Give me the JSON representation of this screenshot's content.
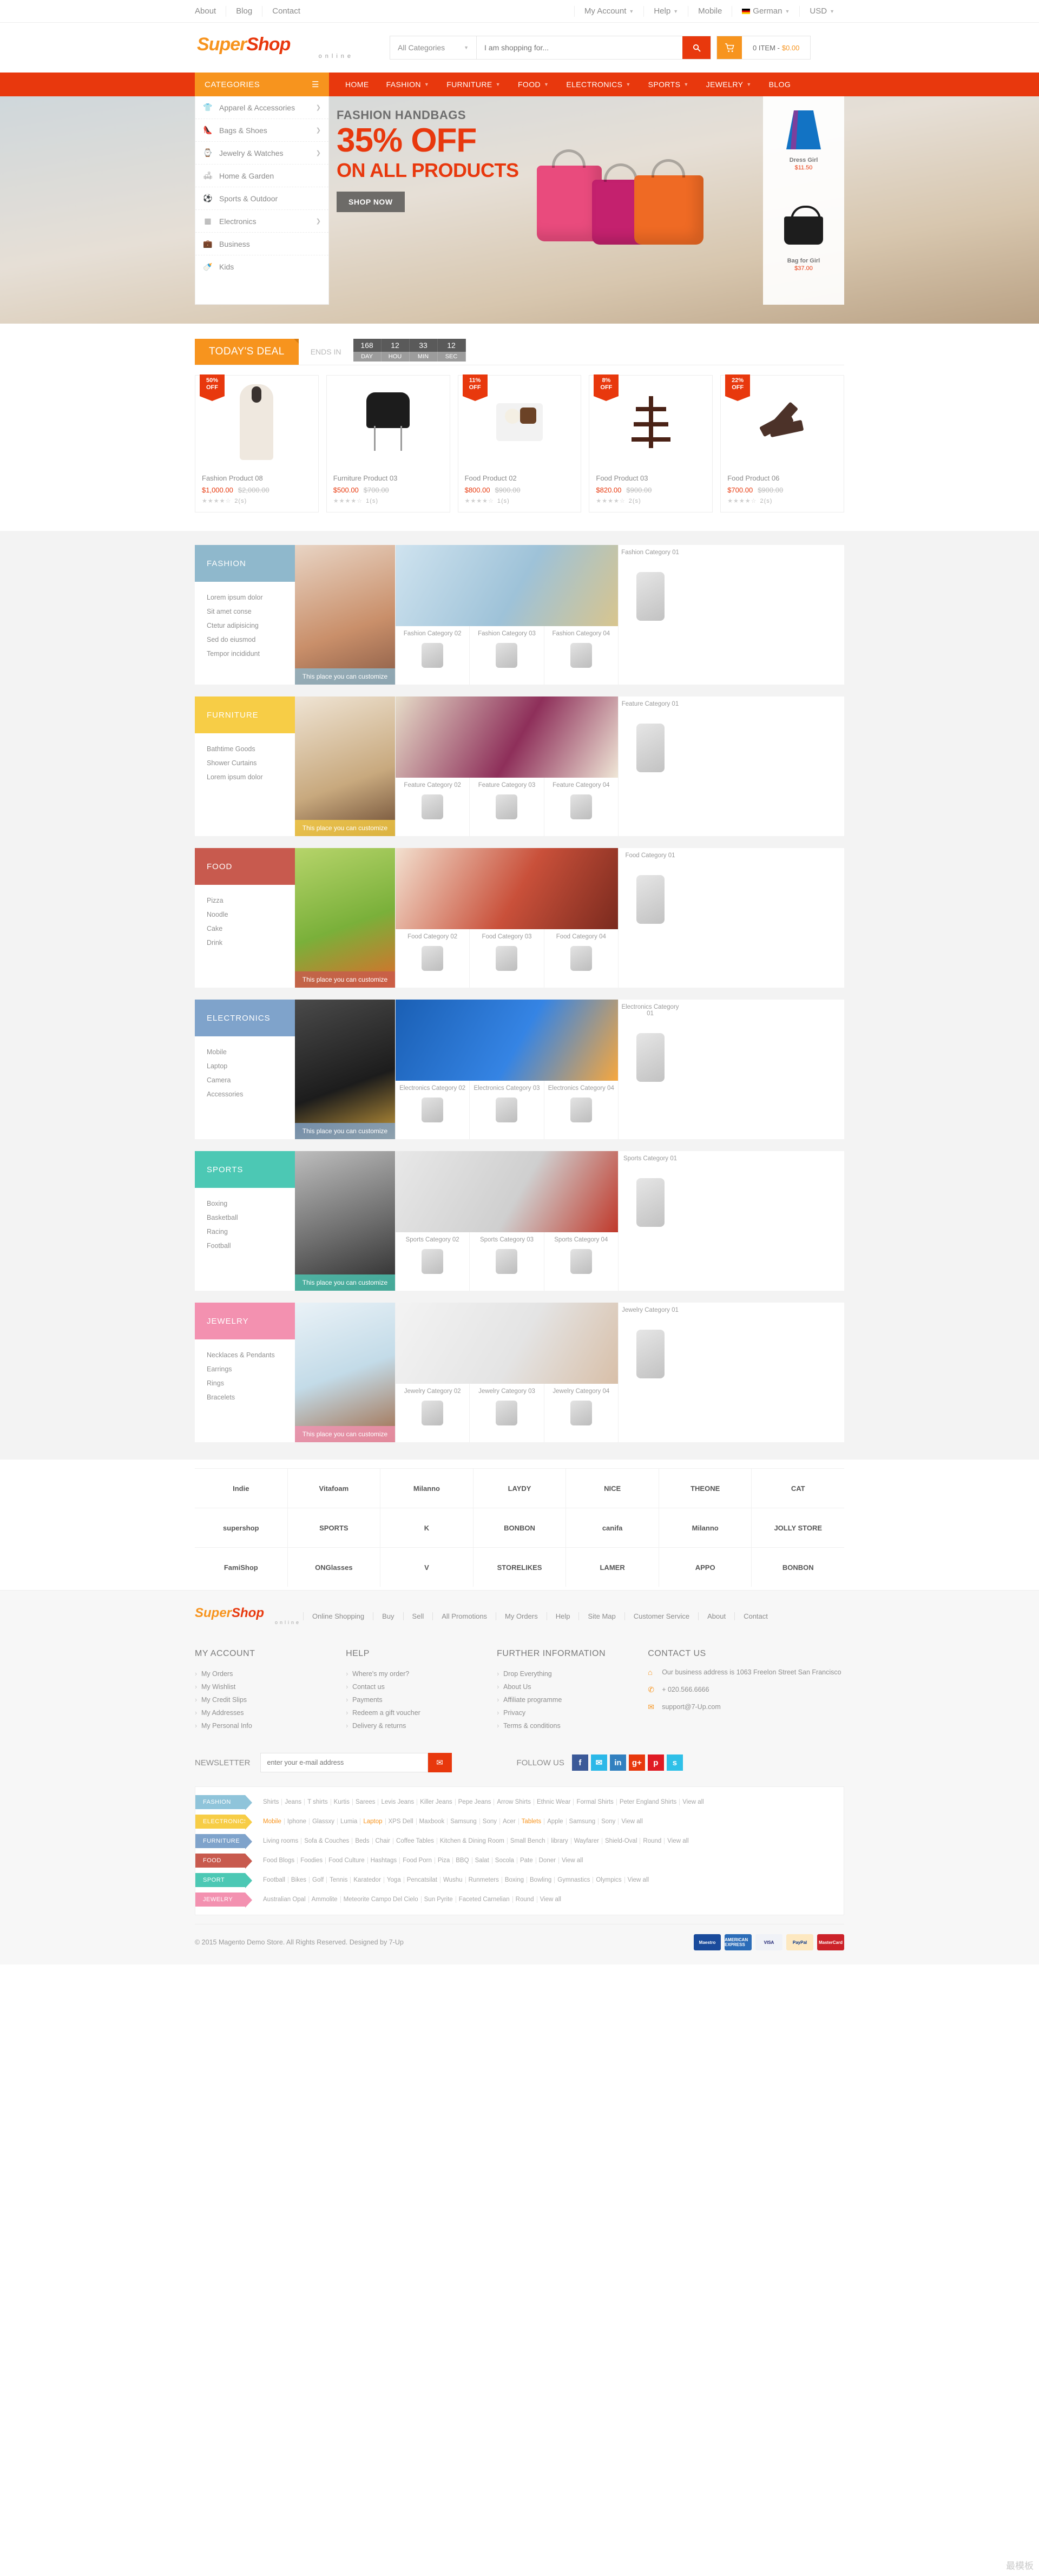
{
  "topbar": {
    "left": [
      "About",
      "Blog",
      "Contact"
    ],
    "right": [
      {
        "label": "My Account",
        "caret": true,
        "icon": null
      },
      {
        "label": "Help",
        "caret": true,
        "icon": null
      },
      {
        "label": "Mobile",
        "caret": false,
        "icon": null
      },
      {
        "label": "German",
        "caret": true,
        "icon": "flag-de-icon"
      },
      {
        "label": "USD",
        "caret": true,
        "icon": null
      }
    ]
  },
  "header": {
    "logo": {
      "part1": "Super",
      "part2": "Shop",
      "tagline": "online"
    },
    "search": {
      "category": "All Categories",
      "placeholder": "I am shopping for...",
      "button_icon": "search-icon"
    },
    "cart": {
      "icon": "cart-icon",
      "count_label": "0 ITEM -",
      "amount": "$0.00"
    }
  },
  "nav": {
    "categories_label": "CATEGORIES",
    "menu_icon": "hamburger-icon",
    "links": [
      {
        "label": "HOME",
        "caret": false
      },
      {
        "label": "FASHION",
        "caret": true
      },
      {
        "label": "FURNITURE",
        "caret": true
      },
      {
        "label": "FOOD",
        "caret": true
      },
      {
        "label": "ELECTRONICS",
        "caret": true
      },
      {
        "label": "SPORTS",
        "caret": true
      },
      {
        "label": "JEWELRY",
        "caret": true
      },
      {
        "label": "BLOG",
        "caret": false
      }
    ]
  },
  "category_panel": [
    {
      "label": "Apparel & Accessories",
      "icon": "tshirt-icon",
      "arrow": true
    },
    {
      "label": "Bags & Shoes",
      "icon": "shoe-icon",
      "arrow": true
    },
    {
      "label": "Jewelry & Watches",
      "icon": "watch-icon",
      "arrow": true
    },
    {
      "label": "Home & Garden",
      "icon": "sofa-icon",
      "arrow": false
    },
    {
      "label": "Sports & Outdoor",
      "icon": "ball-icon",
      "arrow": false
    },
    {
      "label": "Electronics",
      "icon": "chip-icon",
      "arrow": true
    },
    {
      "label": "Business",
      "icon": "briefcase-icon",
      "arrow": false
    },
    {
      "label": "Kids",
      "icon": "bottle-icon",
      "arrow": false
    }
  ],
  "hero": {
    "eyebrow": "FASHION HANDBAGS",
    "headline": "35% OFF",
    "subhead": "ON ALL PRODUCTS",
    "cta": "SHOP NOW",
    "side_products": [
      {
        "name": "Dress Girl",
        "price": "$11.50",
        "art": "skirt"
      },
      {
        "name": "Bag for Girl",
        "price": "$37.00",
        "art": "handbag"
      }
    ]
  },
  "deals": {
    "title": "TODAY'S DEAL",
    "ends_in": "ENDS IN",
    "counter": [
      {
        "value": "168",
        "label": "DAY"
      },
      {
        "value": "12",
        "label": "HOU"
      },
      {
        "value": "33",
        "label": "MIN"
      },
      {
        "value": "12",
        "label": "SEC"
      }
    ],
    "products": [
      {
        "badge": "50%",
        "badge_sub": "OFF",
        "name": "Fashion Product 08",
        "price": "$1,000.00",
        "old": "$2,000.00",
        "stars": 4,
        "reviews": "2(s)",
        "art": "coat"
      },
      {
        "badge": null,
        "badge_sub": null,
        "name": "Furniture Product 03",
        "price": "$500.00",
        "old": "$700.00",
        "stars": 4,
        "reviews": "1(s)",
        "art": "chair"
      },
      {
        "badge": "11%",
        "badge_sub": "OFF",
        "name": "Food Product 02",
        "price": "$800.00",
        "old": "$900.00",
        "stars": 4,
        "reviews": "1(s)",
        "art": "truffle"
      },
      {
        "badge": "8%",
        "badge_sub": "OFF",
        "name": "Food Product 03",
        "price": "$820.00",
        "old": "$900.00",
        "stars": 4,
        "reviews": "2(s)",
        "art": "drizzle"
      },
      {
        "badge": "22%",
        "badge_sub": "OFF",
        "name": "Food Product 06",
        "price": "$700.00",
        "old": "$900.00",
        "stars": 4,
        "reviews": "2(s)",
        "art": "bars"
      }
    ]
  },
  "sections": [
    {
      "title": "FASHION",
      "color": "#8fb8cc",
      "caption": "This place you can customize",
      "links": [
        "Lorem ipsum dolor",
        "Sit amet conse",
        "Ctetur adipisicing",
        "Sed do eiusmod",
        "Tempor incididunt"
      ],
      "cells": [
        {
          "label": "Fashion Category 02",
          "art": "jeans"
        },
        {
          "label": "Fashion Category 03",
          "art": "sunglasses"
        },
        {
          "label": "Fashion Category 04",
          "art": "dress"
        }
      ],
      "right": {
        "label": "Fashion Category 01",
        "art": "blouse"
      },
      "feature_art": "woman-curly",
      "banner_art": "couple-selfie"
    },
    {
      "title": "FURNITURE",
      "color": "#f7cd46",
      "caption": "This place you can customize",
      "links": [
        "Bathtime Goods",
        "Shower Curtains",
        "Lorem ipsum dolor"
      ],
      "cells": [
        {
          "label": "Feature Category 02",
          "art": "dresser"
        },
        {
          "label": "Feature Category 03",
          "art": "stool"
        },
        {
          "label": "Feature Category 04",
          "art": "lamp"
        }
      ],
      "right": {
        "label": "Feature Category 01",
        "art": "lampshade"
      },
      "feature_art": "living-room",
      "banner_art": "purple-sofa"
    },
    {
      "title": "FOOD",
      "color": "#c85a4e",
      "caption": "This place you can customize",
      "links": [
        "Pizza",
        "Noodle",
        "Cake",
        "Drink"
      ],
      "cells": [
        {
          "label": "Food Category 02",
          "art": "coffee-cup"
        },
        {
          "label": "Food Category 03",
          "art": "lime"
        },
        {
          "label": "Food Category 04",
          "art": "glass"
        }
      ],
      "right": {
        "label": "Food Category 01",
        "art": "latte"
      },
      "feature_art": "veggies",
      "banner_art": "meat-dish"
    },
    {
      "title": "ELECTRONICS",
      "color": "#7fa3cb",
      "caption": "This place you can customize",
      "links": [
        "Mobile",
        "Laptop",
        "Camera",
        "Accessories"
      ],
      "cells": [
        {
          "label": "Electronics Category 02",
          "art": "green-phone"
        },
        {
          "label": "Electronics Category 03",
          "art": "white-phone"
        },
        {
          "label": "Electronics Category 04",
          "art": "galaxy-phone"
        }
      ],
      "right": {
        "label": "Electronics Category 01",
        "art": "yellow-camera"
      },
      "feature_art": "dslr-lens",
      "banner_art": "personalize-phone"
    },
    {
      "title": "SPORTS",
      "color": "#4cc8b4",
      "caption": "This place you can customize",
      "links": [
        "Boxing",
        "Basketball",
        "Racing",
        "Football"
      ],
      "cells": [
        {
          "label": "Sports Category 02",
          "art": "blue-helmet"
        },
        {
          "label": "Sports Category 03",
          "art": "red-helmet"
        },
        {
          "label": "Sports Category 04",
          "art": "blue-skirt"
        }
      ],
      "right": {
        "label": "Sports Category 01",
        "art": "racket"
      },
      "feature_art": "man-jacket",
      "banner_art": "red-cleat"
    },
    {
      "title": "JEWELRY",
      "color": "#f391b0",
      "caption": "This place you can customize",
      "links": [
        "Necklaces & Pendants",
        "Earrings",
        "Rings",
        "Bracelets"
      ],
      "cells": [
        {
          "label": "Jewelry Category 02",
          "art": "earrings"
        },
        {
          "label": "Jewelry Category 03",
          "art": "pendant"
        },
        {
          "label": "Jewelry Category 04",
          "art": "gem-ring"
        }
      ],
      "right": {
        "label": "Jewelry Category 01",
        "art": "gold-ring"
      },
      "feature_art": "big-gem",
      "banner_art": "hands-ring"
    }
  ],
  "brands": {
    "row1": [
      "Indie",
      "Vitafoam",
      "Milanno",
      "LAYDY",
      "NICE",
      "THEONE",
      "CAT"
    ],
    "row2": [
      "supershop",
      "SPORTS",
      "K",
      "BONBON",
      "canifa",
      "Milanno",
      "JOLLY STORE"
    ],
    "row3": [
      "FamiShop",
      "ONGlasses",
      "V",
      "STORELIKES",
      "LAMER",
      "APPO",
      "BONBON"
    ]
  },
  "footer": {
    "logo": {
      "part1": "Super",
      "part2": "Shop",
      "tagline": "online"
    },
    "toplinks": [
      "Online Shopping",
      "Buy",
      "Sell",
      "All Promotions",
      "My Orders",
      "Help",
      "Site Map",
      "Customer Service",
      "About",
      "Contact"
    ],
    "columns": [
      {
        "heading": "MY ACCOUNT",
        "items": [
          "My Orders",
          "My Wishlist",
          "My Credit Slips",
          "My Addresses",
          "My Personal Info"
        ]
      },
      {
        "heading": "HELP",
        "items": [
          "Where's my order?",
          "Contact us",
          "Payments",
          "Redeem a gift voucher",
          "Delivery & returns"
        ]
      },
      {
        "heading": "FURTHER INFORMATION",
        "items": [
          "Drop Everything",
          "About Us",
          "Affiliate programme",
          "Privacy",
          "Terms & conditions"
        ]
      }
    ],
    "contact": {
      "heading": "CONTACT US",
      "rows": [
        {
          "icon": "home-icon",
          "text": "Our business address is 1063 Freelon Street San Francisco"
        },
        {
          "icon": "phone-icon",
          "text": "+ 020.566.6666"
        },
        {
          "icon": "mail-icon",
          "text": "support@7-Up.com"
        }
      ]
    },
    "newsletter": {
      "label": "NEWSLETTER",
      "placeholder": "enter your e-mail address",
      "button_icon": "envelope-icon"
    },
    "follow": {
      "label": "FOLLOW US",
      "socials": [
        {
          "name": "facebook-icon",
          "glyph": "f",
          "color": "#3b5998"
        },
        {
          "name": "twitter-icon",
          "glyph": "✉",
          "color": "#2bb8e8"
        },
        {
          "name": "linkedin-icon",
          "glyph": "in",
          "color": "#3280bf"
        },
        {
          "name": "googleplus-icon",
          "glyph": "g+",
          "color": "#e8380d"
        },
        {
          "name": "pinterest-icon",
          "glyph": "p",
          "color": "#e01b24"
        },
        {
          "name": "skype-icon",
          "glyph": "s",
          "color": "#2fc0e8"
        }
      ]
    },
    "tags": [
      {
        "label": "FASHION",
        "color": "#8fc4da",
        "items": [
          {
            "t": "Shirts"
          },
          {
            "t": "Jeans"
          },
          {
            "t": "T shirts"
          },
          {
            "t": "Kurtis"
          },
          {
            "t": "Sarees"
          },
          {
            "t": "Levis Jeans"
          },
          {
            "t": "Killer Jeans"
          },
          {
            "t": "Pepe Jeans"
          },
          {
            "t": "Arrow Shirts"
          },
          {
            "t": "Ethnic Wear"
          },
          {
            "t": "Formal Shirts"
          },
          {
            "t": "Peter England Shirts"
          },
          {
            "t": "View all"
          }
        ]
      },
      {
        "label": "ELECTRONICS",
        "color": "#f7cd46",
        "items": [
          {
            "t": "Mobile",
            "hl": true
          },
          {
            "t": "Iphone"
          },
          {
            "t": "Glassxy"
          },
          {
            "t": "Lumia"
          },
          {
            "t": "Laptop",
            "hl": true
          },
          {
            "t": "XPS Dell"
          },
          {
            "t": "Maxbook"
          },
          {
            "t": "Samsung"
          },
          {
            "t": "Sony"
          },
          {
            "t": "Acer"
          },
          {
            "t": "Tablets",
            "hl": true
          },
          {
            "t": "Apple"
          },
          {
            "t": "Samsung"
          },
          {
            "t": "Sony"
          },
          {
            "t": "View all"
          }
        ]
      },
      {
        "label": "FURNITURE",
        "color": "#7fa3cb",
        "items": [
          {
            "t": "Living rooms"
          },
          {
            "t": "Sofa & Couches"
          },
          {
            "t": "Beds"
          },
          {
            "t": "Chair"
          },
          {
            "t": "Coffee Tables"
          },
          {
            "t": "Kitchen & Dining Room"
          },
          {
            "t": "Small Bench"
          },
          {
            "t": "library"
          },
          {
            "t": "Wayfarer"
          },
          {
            "t": "Shield-Oval"
          },
          {
            "t": "Round"
          },
          {
            "t": "View all"
          }
        ]
      },
      {
        "label": "FOOD",
        "color": "#c85a4e",
        "items": [
          {
            "t": "Food Blogs"
          },
          {
            "t": "Foodies"
          },
          {
            "t": "Food Culture"
          },
          {
            "t": "Hashtags"
          },
          {
            "t": "Food Porn"
          },
          {
            "t": "Piza"
          },
          {
            "t": "BBQ"
          },
          {
            "t": "Salat"
          },
          {
            "t": "Socola"
          },
          {
            "t": "Pate"
          },
          {
            "t": "Doner"
          },
          {
            "t": "View all"
          }
        ]
      },
      {
        "label": "SPORT",
        "color": "#4cc8b4",
        "items": [
          {
            "t": "Football"
          },
          {
            "t": "Bikes"
          },
          {
            "t": "Golf"
          },
          {
            "t": "Tennis"
          },
          {
            "t": "Karatedor"
          },
          {
            "t": "Yoga"
          },
          {
            "t": "Pencatsilat"
          },
          {
            "t": "Wushu"
          },
          {
            "t": "Runmeters"
          },
          {
            "t": "Boxing"
          },
          {
            "t": "Bowling"
          },
          {
            "t": "Gymnastics"
          },
          {
            "t": "Olympics"
          },
          {
            "t": "View all"
          }
        ]
      },
      {
        "label": "JEWELRY",
        "color": "#f391b0",
        "items": [
          {
            "t": "Australian Opal"
          },
          {
            "t": "Ammolite"
          },
          {
            "t": "Meteorite Campo Del Cielo"
          },
          {
            "t": "Sun Pyrite"
          },
          {
            "t": "Faceted Carnelian"
          },
          {
            "t": "Round"
          },
          {
            "t": "View all"
          }
        ]
      }
    ],
    "copyright": "© 2015 Magento Demo Store. All Rights Reserved. Designed by 7-Up",
    "payments": [
      {
        "name": "maestro-icon",
        "label": "Maestro",
        "color": "#1a4b9c"
      },
      {
        "name": "amex-icon",
        "label": "AMERICAN EXPRESS",
        "color": "#2b6cb8"
      },
      {
        "name": "visa-icon",
        "label": "VISA",
        "color": "#f0f2f7",
        "text": "#1a1f71"
      },
      {
        "name": "paypal-icon",
        "label": "PayPal",
        "color": "#fde8c0",
        "text": "#003087"
      },
      {
        "name": "mastercard-icon",
        "label": "MasterCard",
        "color": "#cc2229"
      }
    ],
    "watermark": "最模板"
  },
  "colors": {
    "brand_red": "#e8380d",
    "brand_orange": "#f7941e"
  }
}
